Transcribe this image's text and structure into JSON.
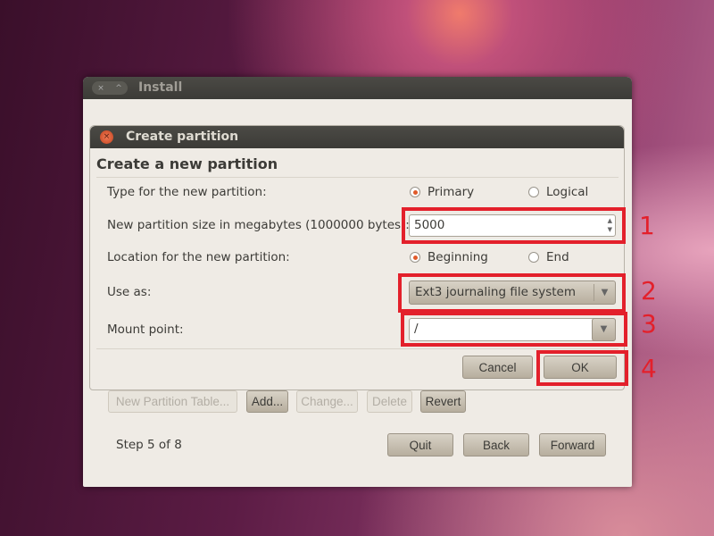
{
  "window": {
    "title": "Install",
    "close": "×",
    "max": "^"
  },
  "dialog": {
    "title": "Create partition",
    "heading": "Create a new partition",
    "type_label": "Type for the new partition:",
    "primary": "Primary",
    "logical": "Logical",
    "size_label": "New partition size in megabytes (1000000 bytes):",
    "size_value": "5000",
    "location_label": "Location for the new partition:",
    "beginning": "Beginning",
    "end": "End",
    "use_as_label": "Use as:",
    "use_as_value": "Ext3 journaling file system",
    "mount_label": "Mount point:",
    "mount_value": "/",
    "cancel": "Cancel",
    "ok": "OK"
  },
  "toolbar": {
    "new_table": "New Partition Table...",
    "add": "Add...",
    "change": "Change...",
    "delete": "Delete",
    "revert": "Revert"
  },
  "footer": {
    "step": "Step 5 of 8",
    "quit": "Quit",
    "back": "Back",
    "forward": "Forward"
  },
  "annotations": [
    "1",
    "2",
    "3",
    "4"
  ]
}
